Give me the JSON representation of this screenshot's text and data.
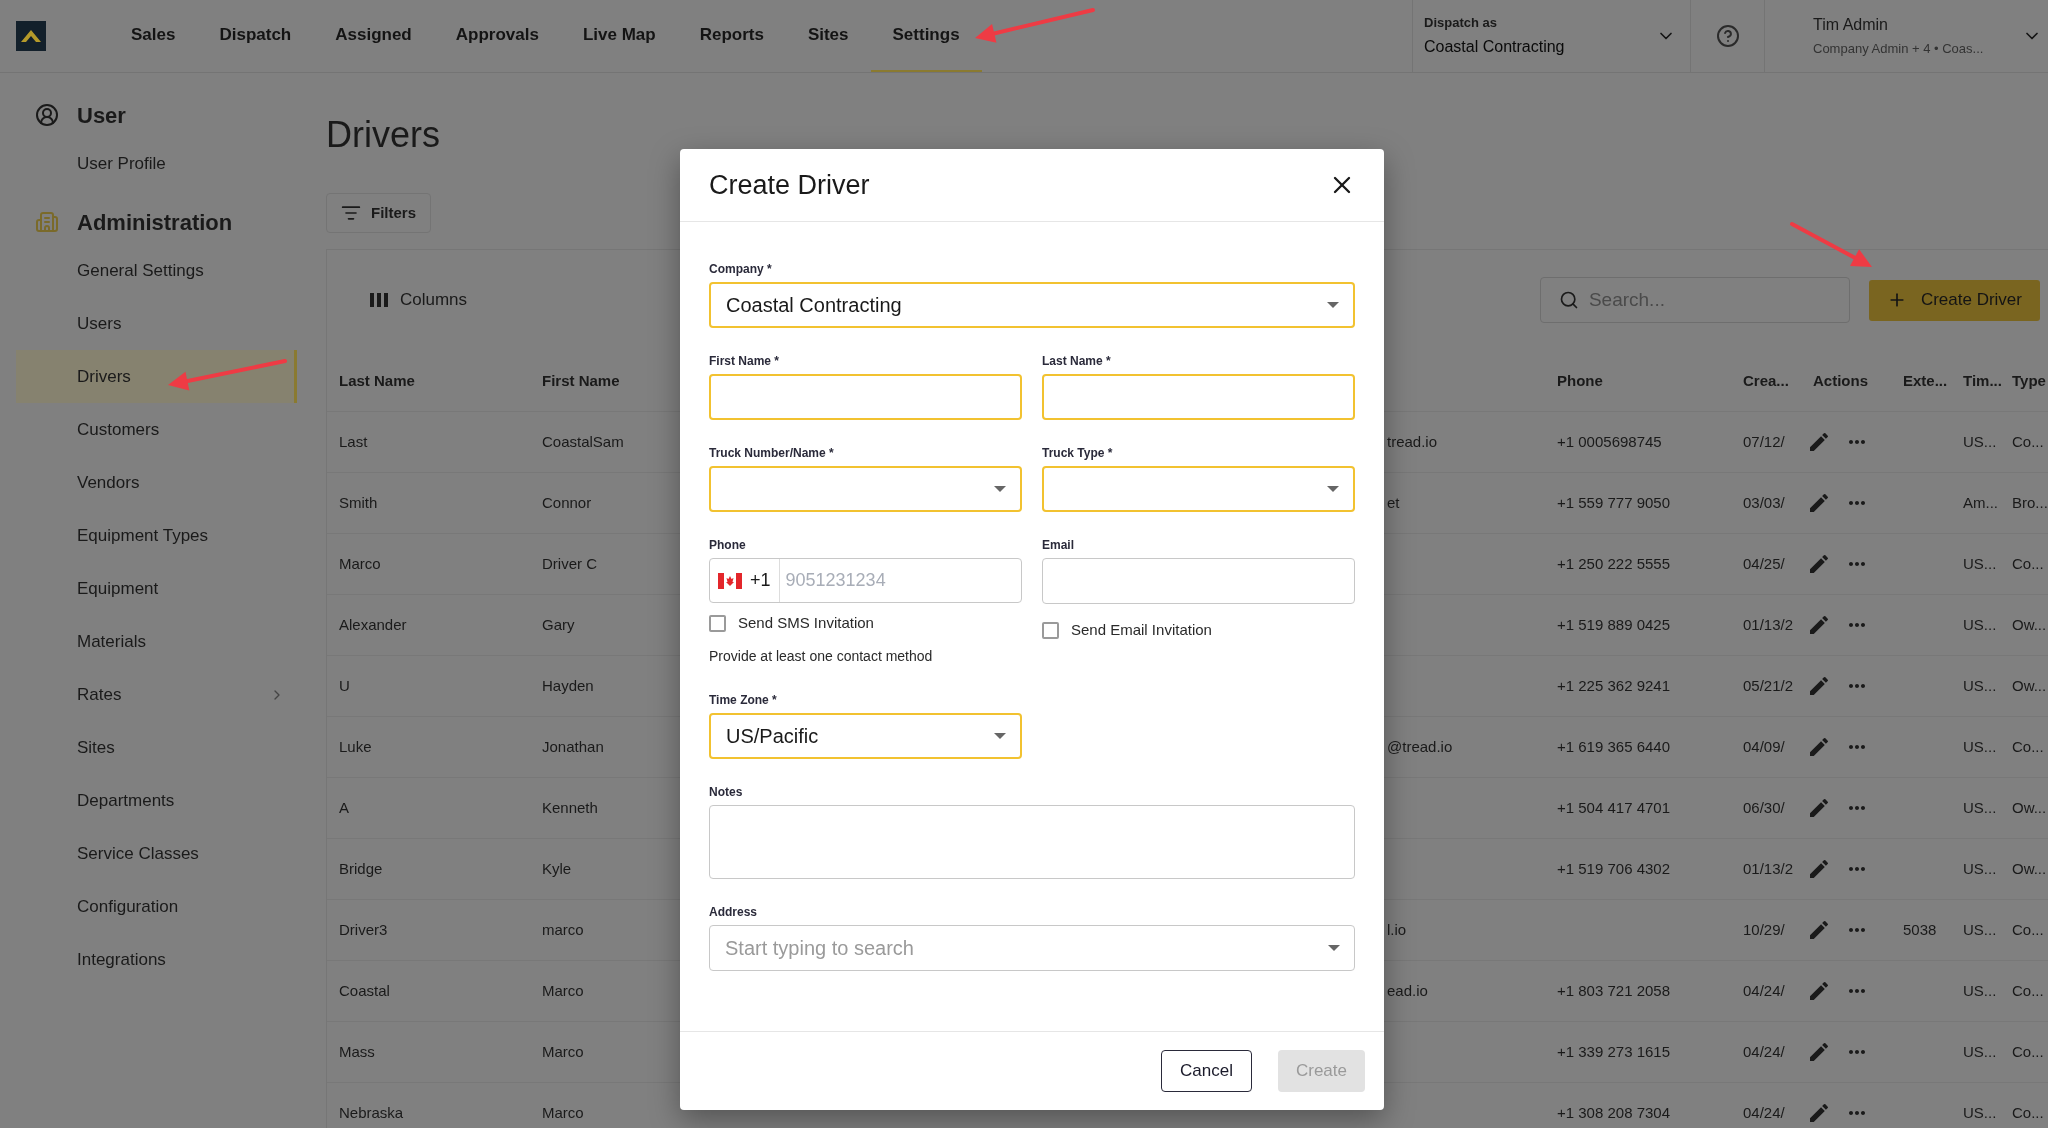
{
  "top_nav": {
    "items": [
      {
        "label": "Sales",
        "selected": false
      },
      {
        "label": "Dispatch",
        "selected": false
      },
      {
        "label": "Assigned",
        "selected": false
      },
      {
        "label": "Approvals",
        "selected": false
      },
      {
        "label": "Live Map",
        "selected": false
      },
      {
        "label": "Reports",
        "selected": false
      },
      {
        "label": "Sites",
        "selected": false
      },
      {
        "label": "Settings",
        "selected": true
      }
    ],
    "dispatch_as": {
      "label": "Dispatch as",
      "value": "Coastal Contracting"
    },
    "user": {
      "name": "Tim Admin",
      "subtitle": "Company Admin + 4 • Coas..."
    }
  },
  "sidebar": {
    "sections": [
      {
        "kind": "user",
        "title": "User",
        "items": [
          {
            "label": "User Profile",
            "selected": false
          }
        ]
      },
      {
        "kind": "building",
        "title": "Administration",
        "items": [
          {
            "label": "General Settings",
            "selected": false
          },
          {
            "label": "Users",
            "selected": false
          },
          {
            "label": "Drivers",
            "selected": true
          },
          {
            "label": "Customers",
            "selected": false
          },
          {
            "label": "Vendors",
            "selected": false
          },
          {
            "label": "Equipment Types",
            "selected": false
          },
          {
            "label": "Equipment",
            "selected": false
          },
          {
            "label": "Materials",
            "selected": false
          },
          {
            "label": "Rates",
            "selected": false,
            "has_submenu": true
          },
          {
            "label": "Sites",
            "selected": false
          },
          {
            "label": "Departments",
            "selected": false
          },
          {
            "label": "Service Classes",
            "selected": false
          },
          {
            "label": "Configuration",
            "selected": false
          },
          {
            "label": "Integrations",
            "selected": false
          }
        ]
      }
    ]
  },
  "page": {
    "title": "Drivers",
    "filters_button": "Filters",
    "columns_button": "Columns",
    "search": {
      "placeholder": "Search..."
    },
    "create_button": "Create Driver"
  },
  "table": {
    "columns": [
      "Last Name",
      "First Name",
      "Phone",
      "Crea...",
      "Actions",
      "Exte...",
      "Tim...",
      "Type"
    ],
    "rows": [
      {
        "last_name": "Last",
        "first_name": "CoastalSam",
        "email": "tread.io",
        "phone": "+1 0005698745",
        "created": "07/12/",
        "time_zone": "US...",
        "type": "Co..."
      },
      {
        "last_name": "Smith",
        "first_name": "Connor",
        "email": "et",
        "phone": "+1 559 777 9050",
        "created": "03/03/",
        "time_zone": "Am...",
        "type": "Bro..."
      },
      {
        "last_name": "Marco",
        "first_name": "Driver C",
        "phone": "+1 250 222 5555",
        "created": "04/25/",
        "time_zone": "US...",
        "type": "Co..."
      },
      {
        "last_name": "Alexander",
        "first_name": "Gary",
        "phone": "+1 519 889 0425",
        "created": "01/13/2",
        "time_zone": "US...",
        "type": "Ow..."
      },
      {
        "last_name": "U",
        "first_name": "Hayden",
        "phone": "+1 225 362 9241",
        "created": "05/21/2",
        "time_zone": "US...",
        "type": "Ow..."
      },
      {
        "last_name": "Luke",
        "first_name": "Jonathan",
        "email": "@tread.io",
        "phone": "+1 619 365 6440",
        "created": "04/09/",
        "time_zone": "US...",
        "type": "Co..."
      },
      {
        "last_name": "A",
        "first_name": "Kenneth",
        "phone": "+1 504 417 4701",
        "created": "06/30/",
        "time_zone": "US...",
        "type": "Ow..."
      },
      {
        "last_name": "Bridge",
        "first_name": "Kyle",
        "phone": "+1 519 706 4302",
        "created": "01/13/2",
        "time_zone": "US...",
        "type": "Ow..."
      },
      {
        "last_name": "Driver3",
        "first_name": "marco",
        "email": "l.io",
        "created": "10/29/",
        "extension": "5038",
        "time_zone": "US...",
        "type": "Co..."
      },
      {
        "last_name": "Coastal",
        "first_name": "Marco",
        "email": "ead.io",
        "phone": "+1 803 721 2058",
        "created": "04/24/",
        "time_zone": "US...",
        "type": "Co..."
      },
      {
        "last_name": "Mass",
        "first_name": "Marco",
        "phone": "+1 339 273 1615",
        "created": "04/24/",
        "time_zone": "US...",
        "type": "Co..."
      },
      {
        "last_name": "Nebraska",
        "first_name": "Marco",
        "phone": "+1 308 208 7304",
        "created": "04/24/",
        "time_zone": "US...",
        "type": "Co..."
      }
    ]
  },
  "dialog": {
    "title": "Create Driver",
    "fields": [
      {
        "kind": "select",
        "label": "Company *",
        "value": "Coastal Contracting",
        "highlighted": true
      },
      {
        "kind": "text",
        "label": "First Name *",
        "highlighted": true
      },
      {
        "kind": "text",
        "label": "Last Name *",
        "highlighted": true
      },
      {
        "kind": "select",
        "label": "Truck Number/Name *",
        "highlighted": true
      },
      {
        "kind": "select",
        "label": "Truck Type *",
        "highlighted": true
      },
      {
        "kind": "phone",
        "label": "Phone",
        "country_code": "+1",
        "placeholder": "9051231234",
        "highlighted": false,
        "checkbox": {
          "label": "Send SMS Invitation",
          "checked": false
        },
        "hint": "Provide at least one contact method"
      },
      {
        "kind": "text",
        "label": "Email",
        "highlighted": false,
        "checkbox": {
          "label": "Send Email Invitation",
          "checked": false
        }
      },
      {
        "kind": "select",
        "label": "Time Zone *",
        "value": "US/Pacific",
        "highlighted": true
      },
      {
        "kind": "textarea",
        "label": "Notes",
        "highlighted": false
      },
      {
        "kind": "select",
        "label": "Address",
        "placeholder": "Start typing to search",
        "highlighted": false
      }
    ],
    "buttons": [
      {
        "label": "Cancel",
        "disabled": false
      },
      {
        "label": "Create",
        "disabled": true
      }
    ]
  }
}
